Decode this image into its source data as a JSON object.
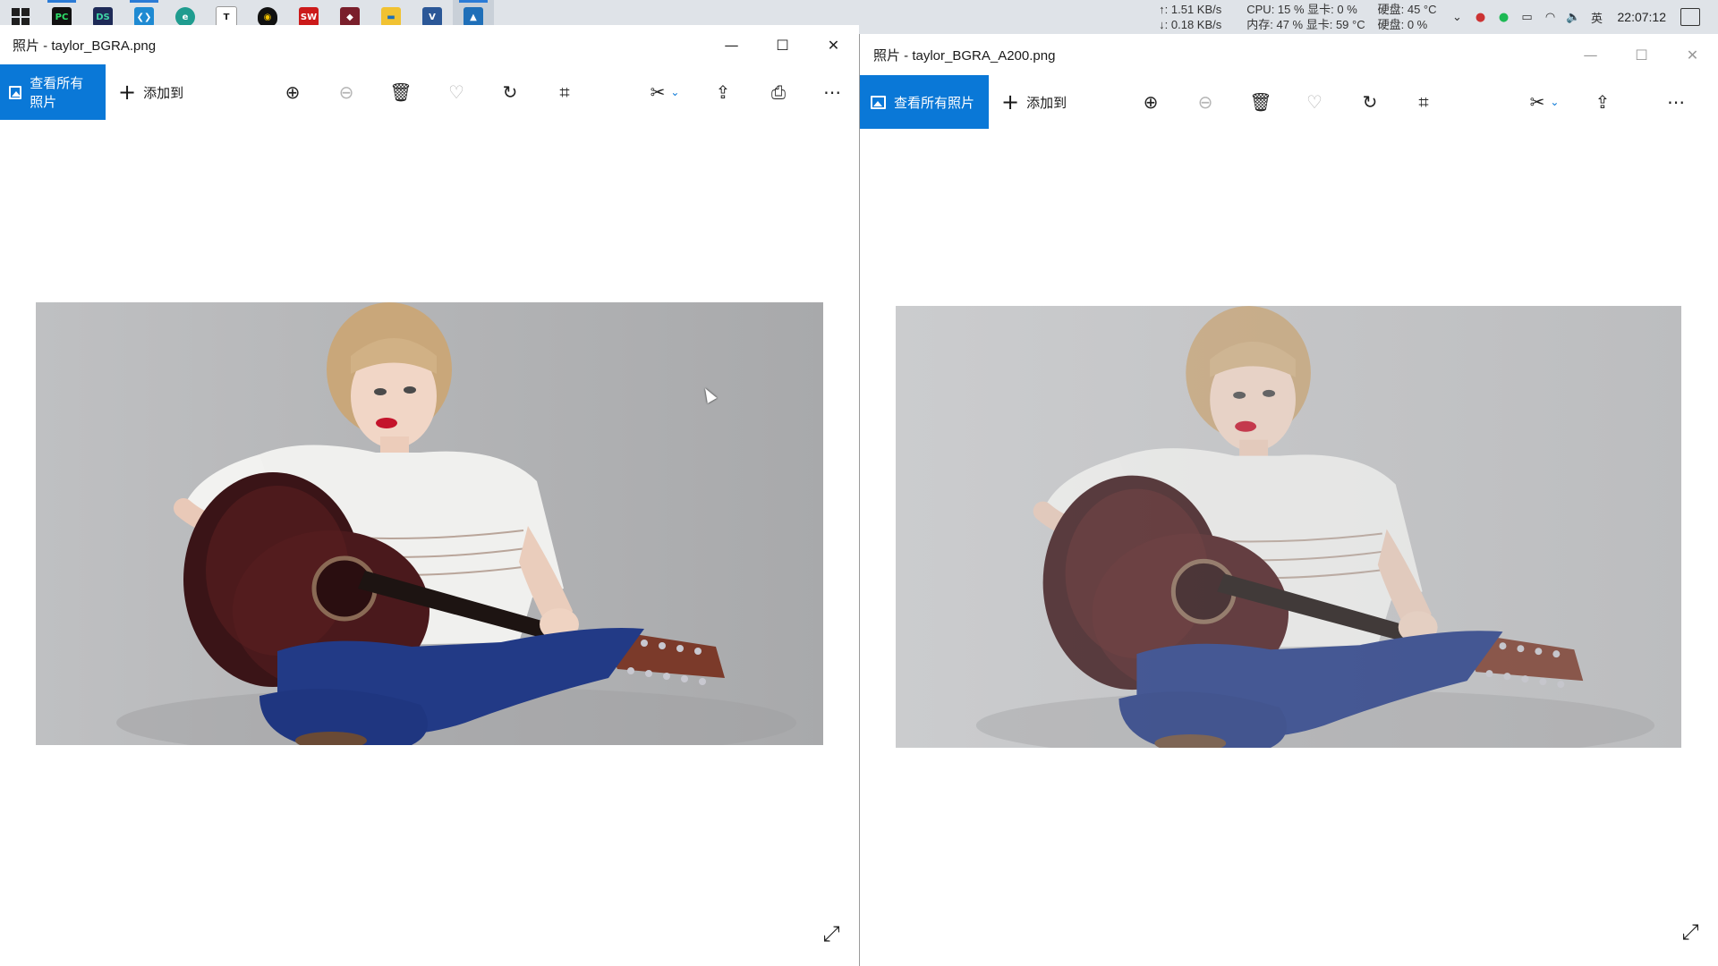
{
  "taskbar": {
    "apps": [
      {
        "name": "PyCharm",
        "glyph": "PC",
        "color": "#1a1a1a"
      },
      {
        "name": "DataSpell",
        "glyph": "DS",
        "color": "#1e2a57"
      },
      {
        "name": "VS Code",
        "glyph": "❮❯",
        "color": "#1f8ad2"
      },
      {
        "name": "Edge",
        "glyph": "e",
        "color": "#1f9c8f"
      },
      {
        "name": "Typora",
        "glyph": "T",
        "color": "#ffffff"
      },
      {
        "name": "QQ",
        "glyph": "Q",
        "color": "#1a1a1a"
      },
      {
        "name": "SolidWorks",
        "glyph": "SW",
        "color": "#cc1a1a"
      },
      {
        "name": "Chrome-like",
        "glyph": "◆",
        "color": "#c0392b"
      },
      {
        "name": "File Explorer",
        "glyph": "▬",
        "color": "#f1c232"
      },
      {
        "name": "Visio",
        "glyph": "V",
        "color": "#2b5797"
      },
      {
        "name": "Photos",
        "glyph": "▲",
        "color": "#1f6fb8"
      }
    ],
    "net_up": "↑: 1.51 KB/s",
    "net_down": "↓: 0.18 KB/s",
    "cpu": "CPU: 15 %  显卡: 0 %",
    "mem": "内存: 47 %  显卡: 59 °C",
    "disk_temp": "硬盘: 45 °C",
    "disk_use": "硬盘: 0 %",
    "ime": "英",
    "clock": "22:07:12"
  },
  "left_window": {
    "title": "照片 - taylor_BGRA.png",
    "view_all": "查看所有照片",
    "add_to": "添加到"
  },
  "right_window": {
    "title": "照片 - taylor_BGRA_A200.png",
    "view_all": "查看所有照片",
    "add_to": "添加到"
  },
  "colors": {
    "accent": "#0a78d7",
    "taskbar_bg": "#dfe3e8"
  },
  "icons": {
    "zoom_in": "zoom-in-icon",
    "zoom_out": "zoom-out-icon",
    "delete": "trash-icon",
    "favorite": "heart-icon",
    "rotate": "rotate-icon",
    "crop": "crop-icon",
    "edit": "edit-create-icon",
    "share": "share-icon",
    "print": "print-icon",
    "more": "more-icon",
    "expand": "fullscreen-icon"
  }
}
